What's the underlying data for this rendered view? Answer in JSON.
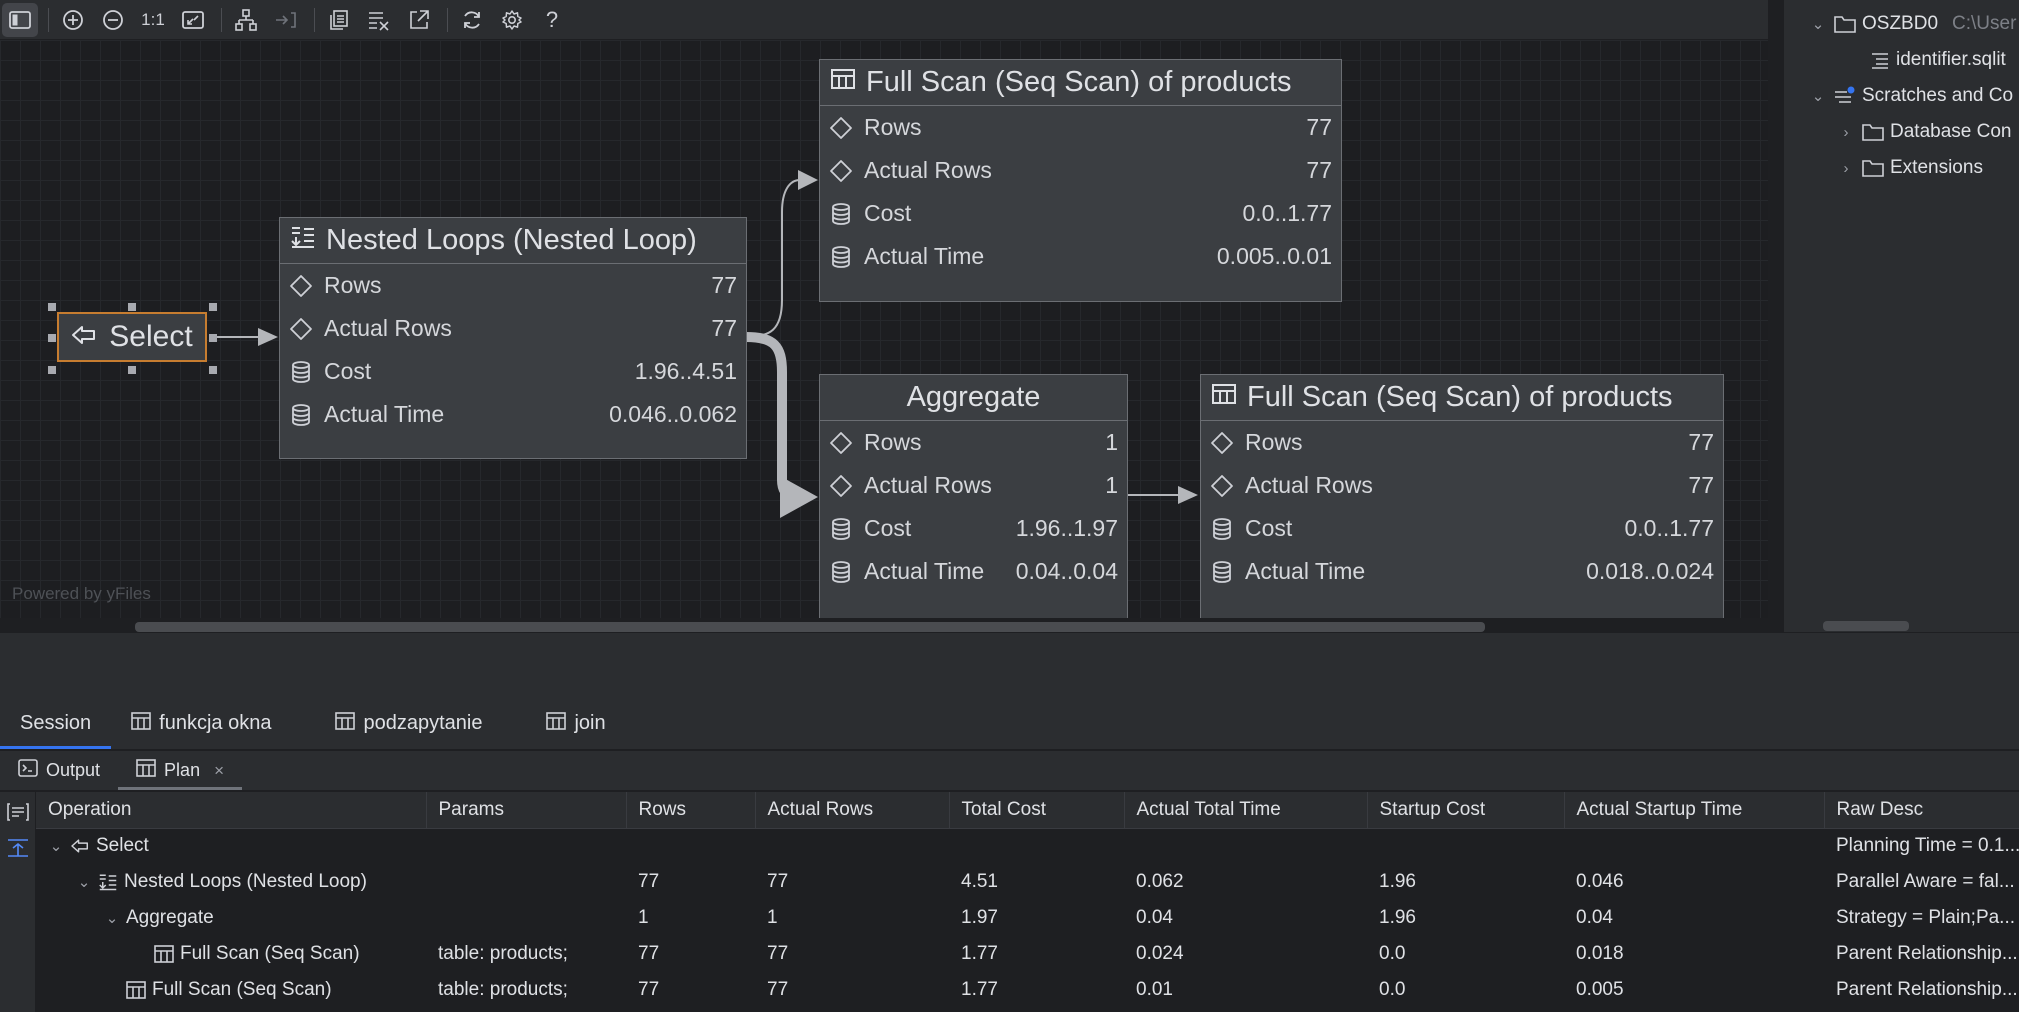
{
  "toolbar": {
    "zoom_label": "1:1",
    "help_label": "?",
    "buttons": [
      "toggle-panel-icon",
      "zoom-in-icon",
      "zoom-out-icon",
      "actual-size",
      "fit-content-icon",
      "layout-icon",
      "collapse-icon",
      "copy-icon",
      "show-details-icon",
      "export-icon",
      "refresh-icon",
      "settings-icon",
      "help"
    ]
  },
  "diagram": {
    "powered_by": "Powered by yFiles",
    "select_node": {
      "label": "Select"
    },
    "nested_loop": {
      "title": "Nested Loops (Nested Loop)",
      "rows": [
        {
          "label": "Rows",
          "value": "77",
          "icon": "diamond-icon"
        },
        {
          "label": "Actual Rows",
          "value": "77",
          "icon": "diamond-icon"
        },
        {
          "label": "Cost",
          "value": "1.96..4.51",
          "icon": "database-icon"
        },
        {
          "label": "Actual Time",
          "value": "0.046..0.062",
          "icon": "database-icon"
        }
      ]
    },
    "scan_top": {
      "title": "Full Scan (Seq Scan) of products",
      "rows": [
        {
          "label": "Rows",
          "value": "77",
          "icon": "diamond-icon"
        },
        {
          "label": "Actual Rows",
          "value": "77",
          "icon": "diamond-icon"
        },
        {
          "label": "Cost",
          "value": "0.0..1.77",
          "icon": "database-icon"
        },
        {
          "label": "Actual Time",
          "value": "0.005..0.01",
          "icon": "database-icon"
        }
      ]
    },
    "aggregate": {
      "title": "Aggregate",
      "rows": [
        {
          "label": "Rows",
          "value": "1",
          "icon": "diamond-icon"
        },
        {
          "label": "Actual Rows",
          "value": "1",
          "icon": "diamond-icon"
        },
        {
          "label": "Cost",
          "value": "1.96..1.97",
          "icon": "database-icon"
        },
        {
          "label": "Actual Time",
          "value": "0.04..0.04",
          "icon": "database-icon"
        }
      ]
    },
    "scan_bottom": {
      "title": "Full Scan (Seq Scan) of products",
      "rows": [
        {
          "label": "Rows",
          "value": "77",
          "icon": "diamond-icon"
        },
        {
          "label": "Actual Rows",
          "value": "77",
          "icon": "diamond-icon"
        },
        {
          "label": "Cost",
          "value": "0.0..1.77",
          "icon": "database-icon"
        },
        {
          "label": "Actual Time",
          "value": "0.018..0.024",
          "icon": "database-icon"
        }
      ]
    }
  },
  "project_tree": {
    "items": [
      {
        "label": "OSZBD0",
        "hint": "C:\\User",
        "icon": "folder-icon",
        "chevron": "v"
      },
      {
        "label": "identifier.sqlit",
        "icon": "file-lines-icon",
        "chevron": ""
      },
      {
        "label": "Scratches and Co",
        "icon": "scratches-icon",
        "chevron": "v"
      },
      {
        "label": "Database Con",
        "icon": "folder-icon",
        "chevron": ">"
      },
      {
        "label": "Extensions",
        "icon": "folder-icon",
        "chevron": ">"
      }
    ]
  },
  "session_tabs": [
    {
      "label": "Session",
      "icon": ""
    },
    {
      "label": "funkcja okna",
      "icon": "table-icon"
    },
    {
      "label": "podzapytanie",
      "icon": "table-icon"
    },
    {
      "label": "join",
      "icon": "table-icon"
    }
  ],
  "result_tabs": {
    "output": "Output",
    "plan": "Plan",
    "close": "×"
  },
  "plan_table": {
    "columns": [
      "Operation",
      "Params",
      "Rows",
      "Actual Rows",
      "Total Cost",
      "Actual Total Time",
      "Startup Cost",
      "Actual Startup Time",
      "Raw Desc"
    ],
    "rows": [
      {
        "expander": "v",
        "icon": "select-icon",
        "operation": "Select",
        "params": "",
        "rows": "",
        "actual_rows": "",
        "total_cost": "",
        "actual_total_time": "",
        "startup_cost": "",
        "actual_startup_time": "",
        "raw_desc": "Planning Time = 0.1..."
      },
      {
        "expander": "v",
        "icon": "nested-loop-icon",
        "operation": "Nested Loops (Nested Loop)",
        "params": "",
        "rows": "77",
        "actual_rows": "77",
        "total_cost": "4.51",
        "actual_total_time": "0.062",
        "startup_cost": "1.96",
        "actual_startup_time": "0.046",
        "raw_desc": "Parallel Aware = fal..."
      },
      {
        "expander": "v",
        "icon": "",
        "operation": "Aggregate",
        "params": "",
        "rows": "1",
        "actual_rows": "1",
        "total_cost": "1.97",
        "actual_total_time": "0.04",
        "startup_cost": "1.96",
        "actual_startup_time": "0.04",
        "raw_desc": "Strategy = Plain;Pa..."
      },
      {
        "expander": "",
        "icon": "table-icon",
        "operation": "Full Scan (Seq Scan)",
        "params": "table: products;",
        "rows": "77",
        "actual_rows": "77",
        "total_cost": "1.77",
        "actual_total_time": "0.024",
        "startup_cost": "0.0",
        "actual_startup_time": "0.018",
        "raw_desc": "Parent Relationship..."
      },
      {
        "expander": "",
        "icon": "table-icon",
        "operation": "Full Scan (Seq Scan)",
        "params": "table: products;",
        "rows": "77",
        "actual_rows": "77",
        "total_cost": "1.77",
        "actual_total_time": "0.01",
        "startup_cost": "0.0",
        "actual_startup_time": "0.005",
        "raw_desc": "Parent Relationship..."
      }
    ]
  },
  "colors": {
    "selection_border": "#c77d30",
    "active_tab_underline": "#3574f0",
    "node_background": "#3b3e42"
  }
}
